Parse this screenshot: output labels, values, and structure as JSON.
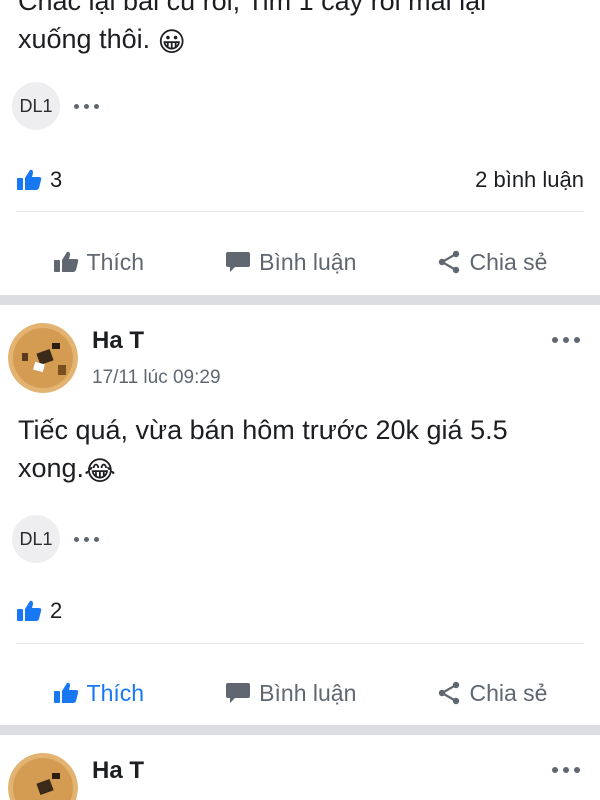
{
  "post1": {
    "text_partial_top": "Chắc lại bài cũ rồi, Tim 1 cây rồi mai lại",
    "text_line2": "xuống thôi.",
    "emoji": "😀",
    "tag_label": "DL1",
    "like_count": "3",
    "comment_count": "2 bình luận"
  },
  "post2": {
    "author": "Ha T",
    "time": "17/11 lúc 09:29",
    "text": "Tiếc quá, vừa bán hôm trước 20k giá 5.5 xong.",
    "emoji": "😂",
    "tag_label": "DL1",
    "like_count": "2"
  },
  "post3": {
    "author": "Ha T"
  },
  "actions": {
    "like": "Thích",
    "comment": "Bình luận",
    "share": "Chia sẻ"
  },
  "colors": {
    "brand_blue": "#1877f2",
    "muted": "#606770",
    "separator": "#dcdde0"
  }
}
